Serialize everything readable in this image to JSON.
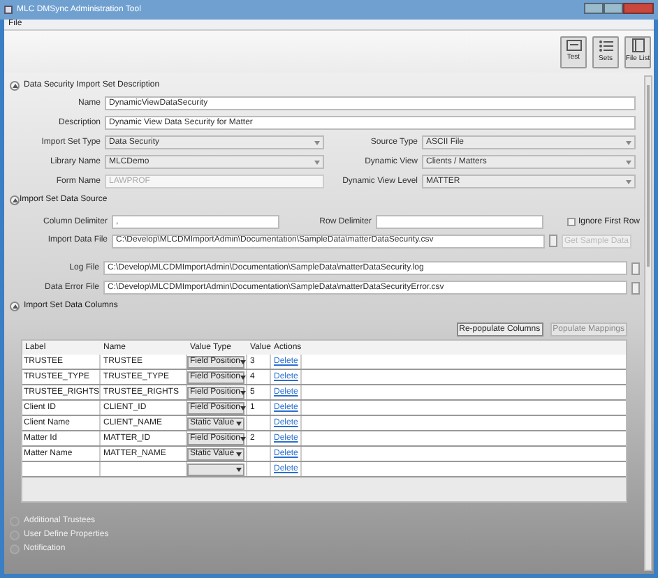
{
  "window": {
    "title": "MLC DMSync Administration Tool"
  },
  "menu": [
    "File"
  ],
  "toolbar": [
    {
      "label": "Test",
      "kind": "test"
    },
    {
      "label": "Sets",
      "kind": "sets"
    },
    {
      "label": "File List",
      "kind": "files"
    }
  ],
  "description_section": {
    "title": "Data Security Import Set Description",
    "expanded": true,
    "name": {
      "label": "Name",
      "value": "DynamicViewDataSecurity"
    },
    "description": {
      "label": "Description",
      "value": "Dynamic View Data Security for Matter"
    },
    "pairs": [
      [
        {
          "label": "Import Set Type",
          "value": "Data Security",
          "kind": "select",
          "disabled": false
        },
        {
          "label": "Source Type",
          "value": "ASCII File",
          "kind": "select",
          "disabled": false
        }
      ],
      [
        {
          "label": "Library Name",
          "value": "MLCDemo",
          "kind": "select",
          "disabled": false
        },
        {
          "label": "Dynamic View",
          "value": "Clients / Matters",
          "kind": "select",
          "disabled": false
        }
      ],
      [
        {
          "label": "Form Name",
          "value": "LAWPROF",
          "kind": "text",
          "disabled": true
        },
        {
          "label": "Dynamic View Level",
          "value": "MATTER",
          "kind": "select",
          "disabled": false
        }
      ]
    ]
  },
  "source_section": {
    "title": "Import Set Data Source",
    "expanded": true,
    "column_delimiter": {
      "label": "Column Delimiter",
      "value": ","
    },
    "row_delimiter": {
      "label": "Row Delimiter"
    },
    "ignore_first_row": {
      "label": "Ignore First Row",
      "checked": false
    },
    "import_data_file": {
      "label": "Import Data File",
      "value": "C:\\Develop\\MLCDMImportAdmin\\Documentation\\SampleData\\matterDataSecurity.csv"
    },
    "get_sample_data": {
      "label": "Get Sample Data",
      "disabled": true
    },
    "log_file": {
      "label": "Log File",
      "value": "C:\\Develop\\MLCDMImportAdmin\\Documentation\\SampleData\\matterDataSecurity.log"
    },
    "data_error_file": {
      "label": "Data Error File",
      "value": "C:\\Develop\\MLCDMImportAdmin\\Documentation\\SampleData\\matterDataSecurityError.csv"
    }
  },
  "columns_section": {
    "title": "Import Set Data Columns",
    "expanded": true,
    "buttons": [
      {
        "label": "Re-populate Columns",
        "disabled": false
      },
      {
        "label": "Populate Mappings",
        "disabled": true
      }
    ],
    "table": {
      "columns": [
        "Label",
        "Name",
        "Value Type",
        "Value",
        "Actions"
      ],
      "rows": [
        {
          "label": "TRUSTEE",
          "name": "TRUSTEE",
          "value_type": "Field Position",
          "value": "3",
          "action": "Delete"
        },
        {
          "label": "TRUSTEE_TYPE",
          "name": "TRUSTEE_TYPE",
          "value_type": "Field Position",
          "value": "4",
          "action": "Delete"
        },
        {
          "label": "TRUSTEE_RIGHTS",
          "name": "TRUSTEE_RIGHTS",
          "value_type": "Field Position",
          "value": "5",
          "action": "Delete"
        },
        {
          "label": "Client ID",
          "name": "CLIENT_ID",
          "value_type": "Field Position",
          "value": "1",
          "action": "Delete"
        },
        {
          "label": "Client Name",
          "name": "CLIENT_NAME",
          "value_type": "Static Value",
          "action": "Delete"
        },
        {
          "label": "Matter Id",
          "name": "MATTER_ID",
          "value_type": "Field Position",
          "value": "2",
          "action": "Delete"
        },
        {
          "label": "Matter Name",
          "name": "MATTER_NAME",
          "value_type": "Static Value",
          "action": "Delete"
        },
        {
          "action": "Delete"
        }
      ]
    }
  },
  "collapsed_sections": [
    {
      "title": "Additional Trustees",
      "expanded": false
    },
    {
      "title": "User Define Properties",
      "expanded": false
    },
    {
      "title": "Notification",
      "expanded": false
    }
  ]
}
